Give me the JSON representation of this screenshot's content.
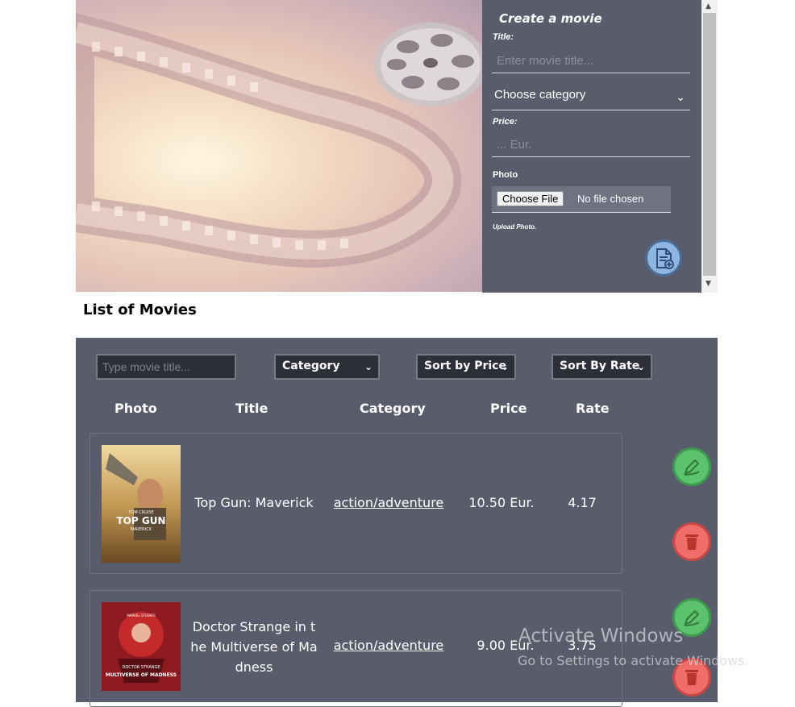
{
  "form": {
    "title": "Create a movie",
    "title_label": "Title:",
    "title_placeholder": "Enter movie title...",
    "category_value": "Choose category",
    "price_label": "Price:",
    "price_placeholder": "... Eur.",
    "photo_label": "Photo",
    "file_button": "Choose File",
    "file_status": "No file chosen",
    "upload_hint": "Upload Photo."
  },
  "list": {
    "heading": "List of Movies",
    "search_placeholder": "Type movie title...",
    "category_filter": "Category",
    "sort_price": "Sort by Price",
    "sort_rate": "Sort By Rate",
    "columns": {
      "photo": "Photo",
      "title": "Title",
      "category": "Category",
      "price": "Price",
      "rate": "Rate"
    },
    "movies": [
      {
        "title": "Top Gun: Maverick",
        "category": "action/adventure",
        "price": "10.50 Eur.",
        "rate": "4.17",
        "poster_title": "TOP GUN",
        "poster_sub": "MAVERICK",
        "poster_actor": "TOM CRUISE"
      },
      {
        "title_line1": "Doctor Strange in t",
        "title_line2": "he Multiverse of Ma",
        "title_line3": "dness",
        "category": "action/adventure",
        "price": "9.00 Eur.",
        "rate": "3.75",
        "poster_title": "MULTIVERSE OF MADNESS",
        "poster_sub": "DOCTOR STRANGE",
        "poster_brand": "MARVEL STUDIOS"
      }
    ]
  },
  "watermark": {
    "line1": "Activate Windows",
    "line2": "Go to Settings to activate Windows."
  },
  "colors": {
    "panel": "#595c6b",
    "edit": "#5cc26d",
    "delete": "#ef6e6a",
    "add": "#8fb6e0"
  }
}
